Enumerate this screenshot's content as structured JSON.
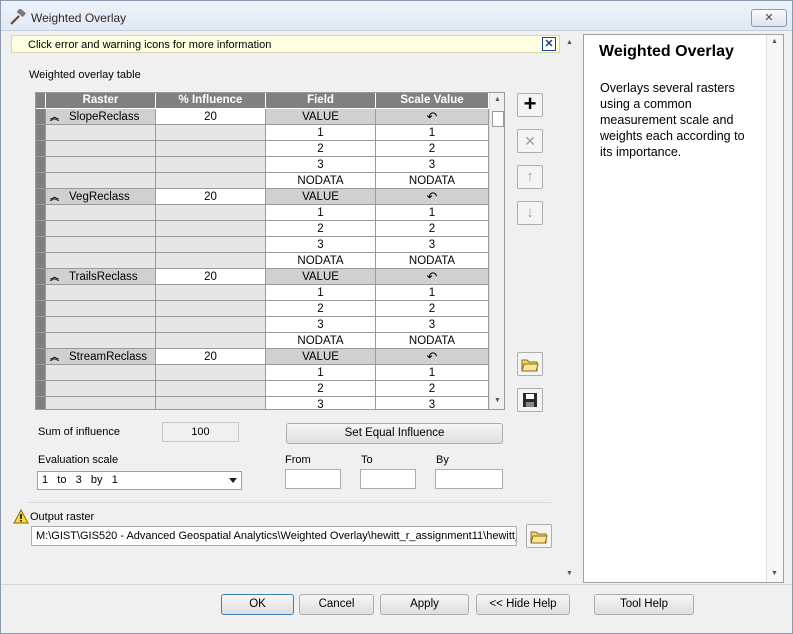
{
  "window": {
    "title": "Weighted Overlay",
    "close_label": "✕"
  },
  "message_bar": {
    "text": "Click error and warning icons for more information",
    "close_label": "✕"
  },
  "table": {
    "label": "Weighted overlay table",
    "columns": [
      "Raster",
      "% Influence",
      "Field",
      "Scale Value"
    ],
    "groups": [
      {
        "raster": "SlopeReclass",
        "influence": "20",
        "field_header": "VALUE",
        "scale_header": "↶",
        "rows": [
          {
            "field": "1",
            "scale": "1"
          },
          {
            "field": "2",
            "scale": "2"
          },
          {
            "field": "3",
            "scale": "3"
          },
          {
            "field": "NODATA",
            "scale": "NODATA"
          }
        ]
      },
      {
        "raster": "VegReclass",
        "influence": "20",
        "field_header": "VALUE",
        "scale_header": "↶",
        "rows": [
          {
            "field": "1",
            "scale": "1"
          },
          {
            "field": "2",
            "scale": "2"
          },
          {
            "field": "3",
            "scale": "3"
          },
          {
            "field": "NODATA",
            "scale": "NODATA"
          }
        ]
      },
      {
        "raster": "TrailsReclass",
        "influence": "20",
        "field_header": "VALUE",
        "scale_header": "↶",
        "rows": [
          {
            "field": "1",
            "scale": "1"
          },
          {
            "field": "2",
            "scale": "2"
          },
          {
            "field": "3",
            "scale": "3"
          },
          {
            "field": "NODATA",
            "scale": "NODATA"
          }
        ]
      },
      {
        "raster": "StreamReclass",
        "influence": "20",
        "field_header": "VALUE",
        "scale_header": "↶",
        "rows": [
          {
            "field": "1",
            "scale": "1"
          },
          {
            "field": "2",
            "scale": "2"
          },
          {
            "field": "3",
            "scale": "3"
          }
        ]
      }
    ]
  },
  "side_buttons": {
    "add": "+",
    "remove": "✕",
    "up": "↑",
    "down": "↓"
  },
  "influence": {
    "sum_label": "Sum of influence",
    "sum_value": "100",
    "set_equal_label": "Set Equal Influence"
  },
  "evaluation": {
    "label": "Evaluation scale",
    "selected": "1   to   3   by   1",
    "from_label": "From",
    "to_label": "To",
    "by_label": "By"
  },
  "output": {
    "label": "Output raster",
    "path": "M:\\GIST\\GIS520 - Advanced Geospatial Analytics\\Weighted Overlay\\hewitt_r_assignment11\\hewitt_"
  },
  "buttons": {
    "ok": "OK",
    "cancel": "Cancel",
    "apply": "Apply",
    "hide_help": "<< Hide Help",
    "tool_help": "Tool Help"
  },
  "help": {
    "title": "Weighted Overlay",
    "body": "Overlays several rasters using a common measurement scale and weights each according to its importance."
  },
  "colors": {
    "header_gray": "#808080",
    "message_yellow": "#ffffe1",
    "accent_blue": "#3c7fb1"
  }
}
